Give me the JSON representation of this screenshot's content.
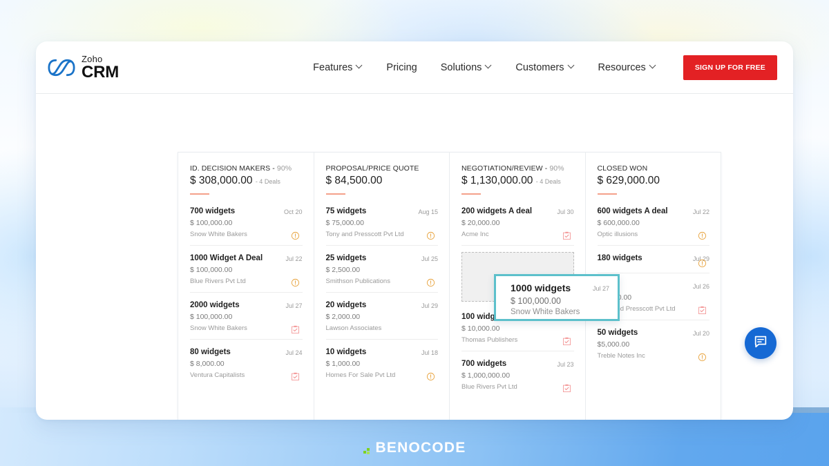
{
  "brand": {
    "logo_icon": "zoho-infinity-icon",
    "logo_top": "Zoho",
    "logo_bottom": "CRM",
    "accent_red": "#e32124"
  },
  "nav": {
    "links": [
      {
        "label": "Features",
        "has_caret": true
      },
      {
        "label": "Pricing",
        "has_caret": false
      },
      {
        "label": "Solutions",
        "has_caret": true
      },
      {
        "label": "Customers",
        "has_caret": true
      },
      {
        "label": "Resources",
        "has_caret": true
      }
    ],
    "cta_label": "SIGN UP FOR FREE"
  },
  "board": {
    "columns": [
      {
        "title": "ID. DECISION MAKERS -",
        "percent": "90%",
        "amount": "$ 308,000.00",
        "deals_count": "- 4 Deals",
        "deals": [
          {
            "name": "700 widgets",
            "date": "Oct 20",
            "amount": "$ 100,000.00",
            "account": "Snow White Bakers",
            "icon": "alert-circle-icon"
          },
          {
            "name": "1000 Widget A Deal",
            "date": "Jul 22",
            "amount": "$ 100,000.00",
            "account": "Blue Rivers Pvt Ltd",
            "icon": "alert-circle-icon"
          },
          {
            "name": "2000 widgets",
            "date": "Jul 27",
            "amount": "$ 100,000.00",
            "account": "Snow White Bakers",
            "icon": "task-clipboard-icon"
          },
          {
            "name": "80 widgets",
            "date": "Jul 24",
            "amount": "$ 8,000.00",
            "account": "Ventura Capitalists",
            "icon": "task-clipboard-icon"
          }
        ]
      },
      {
        "title": "PROPOSAL/PRICE QUOTE",
        "percent": "",
        "amount": "$ 84,500.00",
        "deals_count": "",
        "deals": [
          {
            "name": "75 widgets",
            "date": "Aug 15",
            "amount": "$ 75,000.00",
            "account": "Tony and Presscott Pvt Ltd",
            "icon": "alert-circle-icon"
          },
          {
            "name": "25 widgets",
            "date": "Jul 25",
            "amount": "$ 2,500.00",
            "account": "Smithson Publications",
            "icon": "alert-circle-icon"
          },
          {
            "name": "20 widgets",
            "date": "Jul 29",
            "amount": "$ 2,000.00",
            "account": "Lawson Associates",
            "icon": "none"
          },
          {
            "name": "10 widgets",
            "date": "Jul 18",
            "amount": "$ 1,000.00",
            "account": "Homes For Sale Pvt Ltd",
            "icon": "alert-circle-icon"
          }
        ]
      },
      {
        "title": "NEGOTIATION/REVIEW -",
        "percent": "90%",
        "amount": "$ 1,130,000.00",
        "deals_count": "- 4 Deals",
        "deals": [
          {
            "name": "200 widgets A deal",
            "date": "Jul 30",
            "amount": "$ 20,000.00",
            "account": "Acme Inc",
            "icon": "task-clipboard-icon"
          },
          {
            "name": "100 widgets",
            "date": "",
            "amount": "$ 10,000.00",
            "account": "Thomas Publishers",
            "icon": "task-clipboard-icon"
          },
          {
            "name": "700 widgets",
            "date": "Jul 23",
            "amount": "$ 1,000,000.00",
            "account": "Blue Rivers Pvt Ltd",
            "icon": "task-clipboard-icon"
          }
        ],
        "has_drop_zone": true
      },
      {
        "title": "CLOSED WON",
        "percent": "",
        "amount": "$ 629,000.00",
        "deals_count": "",
        "deals": [
          {
            "name": "600 widgets A deal",
            "date": "Jul 22",
            "amount": "$ 600,000.00",
            "account": "Optic illusions",
            "icon": "alert-circle-icon"
          },
          {
            "name": "180 widgets",
            "date": "Jul 29",
            "amount": "",
            "account": "",
            "icon": "alert-circle-icon"
          },
          {
            "name": "",
            "date": "Jul 26",
            "amount": "$ 6,000.00",
            "account": "Tony and Presscott Pvt Ltd",
            "icon": "task-clipboard-icon"
          },
          {
            "name": "50 widgets",
            "date": "Jul 20",
            "amount": "$5,000.00",
            "account": "Treble Notes Inc",
            "icon": "alert-circle-icon"
          }
        ]
      }
    ]
  },
  "drag_card": {
    "name": "1000 widgets",
    "date": "Jul 27",
    "amount": "$ 100,000.00",
    "account": "Snow White Bakers",
    "border_color": "#5cc0cb"
  },
  "chat": {
    "icon": "chat-bubble-icon",
    "color": "#1669d4"
  },
  "footer": {
    "logo_text": "BENOCODE",
    "dot_color": "#7ed321"
  }
}
